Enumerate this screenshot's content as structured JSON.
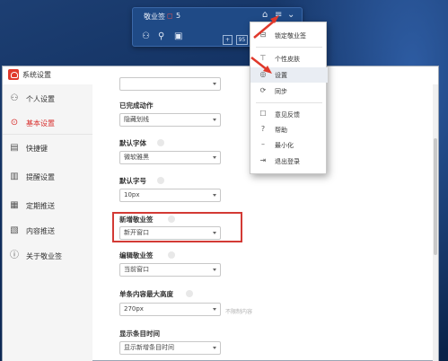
{
  "widget": {
    "title": "敬业签",
    "count": "5",
    "page_number": "95"
  },
  "window": {
    "title": "系统设置"
  },
  "sidebar": {
    "items": [
      {
        "label": "个人设置",
        "icon": "person-icon"
      },
      {
        "label": "基本设置",
        "icon": "gear-icon",
        "active": true
      },
      {
        "label": "快捷键",
        "icon": "keyboard-icon"
      },
      {
        "label": "提醒设置",
        "icon": "bell-icon"
      },
      {
        "label": "定期推送",
        "icon": "calendar-icon"
      },
      {
        "label": "内容推送",
        "icon": "content-icon"
      },
      {
        "label": "关于敬业签",
        "icon": "info-icon"
      }
    ]
  },
  "settings": {
    "completed_label": "已完成动作",
    "completed_value": "隐藏划线",
    "font_label": "默认字体",
    "font_value": "微软雅黑",
    "size_label": "默认字号",
    "size_value": "10px",
    "new_label": "新增敬业签",
    "new_value": "新开窗口",
    "edit_label": "编辑敬业签",
    "edit_value": "当前窗口",
    "height_label": "单条内容最大高度",
    "height_value": "270px",
    "height_hint": "不限制内容",
    "time_label": "显示条目时间",
    "time_value": "显示新增条目时间"
  },
  "menu": {
    "items": [
      {
        "label": "锁定敬业签",
        "icon": "lock-icon"
      },
      {
        "label": "个性皮肤",
        "icon": "shirt-icon"
      },
      {
        "label": "设置",
        "icon": "settings-icon"
      },
      {
        "label": "同步",
        "icon": "sync-icon"
      },
      {
        "label": "意见反馈",
        "icon": "feedback-icon"
      },
      {
        "label": "帮助",
        "icon": "help-icon"
      },
      {
        "label": "最小化",
        "icon": "minimize-icon"
      },
      {
        "label": "退出登录",
        "icon": "logout-icon"
      }
    ]
  },
  "colors": {
    "accent": "#d8302e",
    "annotation": "#e0392b"
  }
}
